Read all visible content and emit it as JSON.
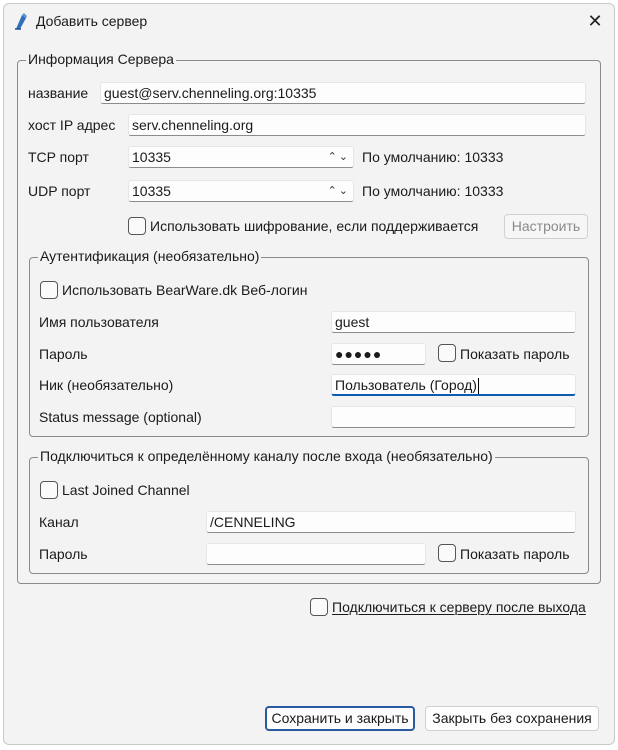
{
  "window": {
    "title": "Добавить сервер",
    "close_glyph": "✕"
  },
  "server_info": {
    "legend": "Информация Сервера",
    "name_label": "название",
    "name_value": "guest@serv.chenneling.org:10335",
    "host_label": "хост  IP адрес",
    "host_value": "serv.chenneling.org",
    "tcp_label": "TCP порт",
    "tcp_value": "10335",
    "tcp_default": "По умолчанию: 10333",
    "udp_label": "UDP порт",
    "udp_value": "10335",
    "udp_default": "По умолчанию: 10333",
    "spin_arrows": "⌃⌄",
    "encrypt_label": "Использовать шифрование, если поддерживается",
    "configure_button": "Настроить"
  },
  "auth": {
    "legend": "Аутентификация (необязательно)",
    "weblogin_label": "Использовать BearWare.dk Веб-логин",
    "username_label": "Имя пользователя",
    "username_value": "guest",
    "password_label": "Пароль",
    "password_value": "●●●●●",
    "show_password_label": "Показать пароль",
    "nick_label": "Ник (необязательно)",
    "nick_value": "Пользователь (Город)",
    "status_label": "Status message (optional)",
    "status_value": ""
  },
  "channel": {
    "legend": "Подключиться к определённому каналу после входа (необязательно)",
    "last_joined_label": "Last Joined Channel",
    "channel_label": "Канал",
    "channel_value": "/CENNELING",
    "password_label": "Пароль",
    "password_value": "",
    "show_password_label": "Показать пароль"
  },
  "reconnect_label": "Подключиться к серверу после выхода",
  "buttons": {
    "save": "Сохранить и закрыть",
    "close_nosave": "Закрыть без сохранения"
  },
  "colors": {
    "accent": "#0b5cad",
    "app_icon": "#2e6fb8"
  }
}
